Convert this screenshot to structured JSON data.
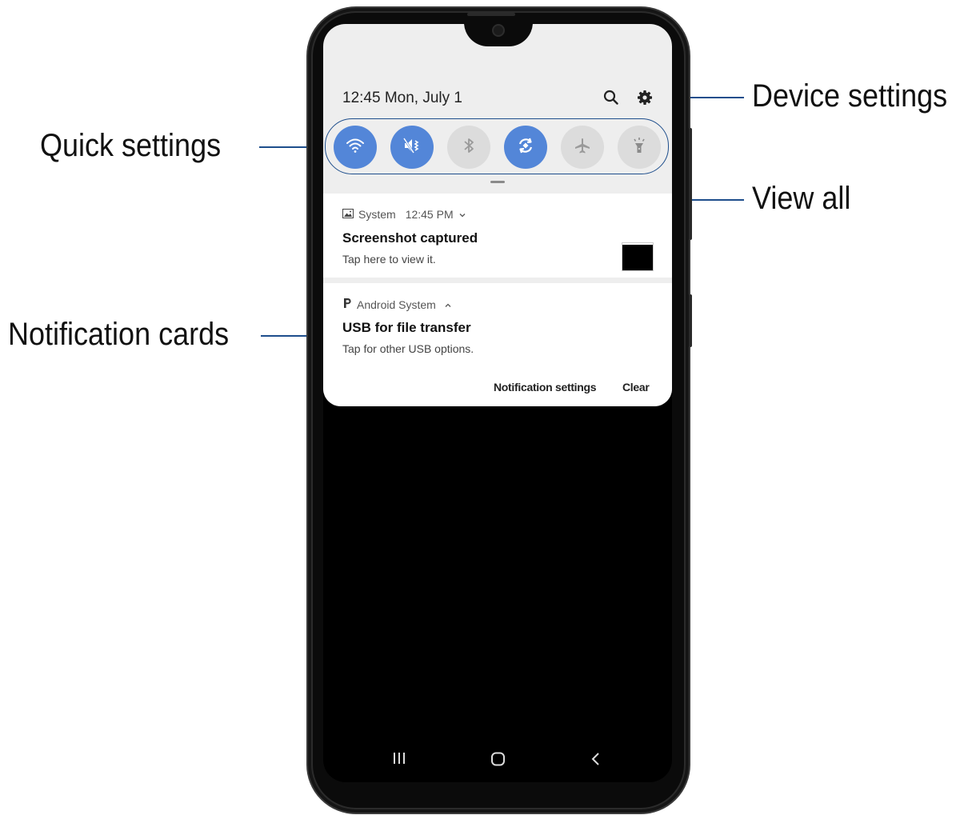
{
  "callouts": {
    "quick_settings": "Quick settings",
    "notification_cards": "Notification cards",
    "device_settings": "Device settings",
    "view_all": "View all"
  },
  "status": {
    "time_date": "12:45  Mon, July 1"
  },
  "top_icons": [
    "search-icon",
    "gear-icon"
  ],
  "quick_settings": [
    {
      "name": "wifi-icon",
      "state": "on"
    },
    {
      "name": "mute-vibrate-icon",
      "state": "on"
    },
    {
      "name": "bluetooth-icon",
      "state": "off"
    },
    {
      "name": "auto-rotate-icon",
      "state": "on"
    },
    {
      "name": "airplane-icon",
      "state": "off"
    },
    {
      "name": "flashlight-icon",
      "state": "off"
    }
  ],
  "notifications": [
    {
      "app": "System",
      "time": "12:45 PM",
      "title": "Screenshot captured",
      "body": "Tap here to view it."
    },
    {
      "app": "Android System",
      "title": "USB for file transfer",
      "body": "Tap for other USB options."
    }
  ],
  "actions": {
    "notification_settings": "Notification settings",
    "clear": "Clear"
  },
  "nav": [
    "recents-icon",
    "home-icon",
    "back-icon"
  ],
  "colors": {
    "accent_on": "#5386d8",
    "toggle_off": "#dcdcdc",
    "callout_line": "#1e4e8c",
    "panel_bg": "#eeeeee"
  }
}
